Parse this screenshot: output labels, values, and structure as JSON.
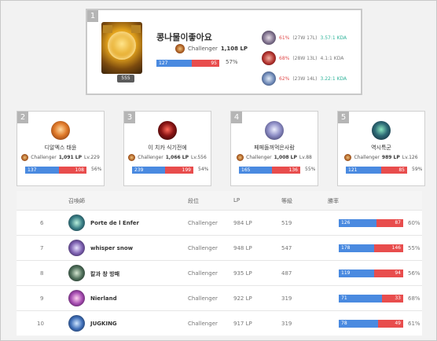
{
  "top": {
    "rank": "1",
    "name": "콩나물이좋아요",
    "level": "555",
    "tier": "Challenger",
    "lp": "1,108 LP",
    "wins": "127",
    "losses": "95",
    "winrate": "57%",
    "champions": [
      {
        "winrate": "61%",
        "record": "(27W 17L)",
        "kda": "3.57:1 KDA",
        "winrate_color": "#e04b4b",
        "kda_color": "#2fb39a",
        "icon": "champion-icon-pale"
      },
      {
        "winrate": "68%",
        "record": "(28W 13L)",
        "kda": "4.1:1 KDA",
        "winrate_color": "#e04b4b",
        "kda_color": "#777777",
        "icon": "champion-icon-red"
      },
      {
        "winrate": "62%",
        "record": "(23W 14L)",
        "kda": "3.22:1 KDA",
        "winrate_color": "#e04b4b",
        "kda_color": "#2fb39a",
        "icon": "champion-icon-blue"
      }
    ]
  },
  "ranked_cards": [
    {
      "rank": "2",
      "name": "디알엑스 태윤",
      "tier": "Challenger",
      "lp": "1,091 LP",
      "level": "Lv.229",
      "wins": "137",
      "losses": "108",
      "winrate": "56%"
    },
    {
      "rank": "3",
      "name": "이 치카 식기전에",
      "tier": "Challenger",
      "lp": "1,066 LP",
      "level": "Lv.556",
      "wins": "239",
      "losses": "199",
      "winrate": "54%"
    },
    {
      "rank": "4",
      "name": "페페돌꺼먹은사람",
      "tier": "Challenger",
      "lp": "1,008 LP",
      "level": "Lv.88",
      "wins": "165",
      "losses": "136",
      "winrate": "55%"
    },
    {
      "rank": "5",
      "name": "역시특군",
      "tier": "Challenger",
      "lp": "989 LP",
      "level": "Lv.126",
      "wins": "121",
      "losses": "85",
      "winrate": "59%"
    }
  ],
  "table": {
    "headers": {
      "summoner": "召喚師",
      "tier": "段位",
      "lp": "LP",
      "level": "等級",
      "winrate": "勝率"
    },
    "rows": [
      {
        "rank": "6",
        "name": "Porte de l Enfer",
        "tier": "Challenger",
        "lp": "984 LP",
        "level": "519",
        "wins": "126",
        "losses": "87",
        "winrate": "60%"
      },
      {
        "rank": "7",
        "name": "whisper snow",
        "tier": "Challenger",
        "lp": "948 LP",
        "level": "547",
        "wins": "178",
        "losses": "146",
        "winrate": "55%"
      },
      {
        "rank": "8",
        "name": "칼과 창 방패",
        "tier": "Challenger",
        "lp": "935 LP",
        "level": "487",
        "wins": "119",
        "losses": "94",
        "winrate": "56%"
      },
      {
        "rank": "9",
        "name": "Nierland",
        "tier": "Challenger",
        "lp": "922 LP",
        "level": "319",
        "wins": "71",
        "losses": "33",
        "winrate": "68%"
      },
      {
        "rank": "10",
        "name": "JUGKING",
        "tier": "Challenger",
        "lp": "917 LP",
        "level": "319",
        "wins": "78",
        "losses": "49",
        "winrate": "61%"
      }
    ]
  },
  "colors": {
    "win": "#4a8ae0",
    "loss": "#e84d4d",
    "accent_green": "#2fb39a",
    "accent_red": "#e04b4b"
  }
}
